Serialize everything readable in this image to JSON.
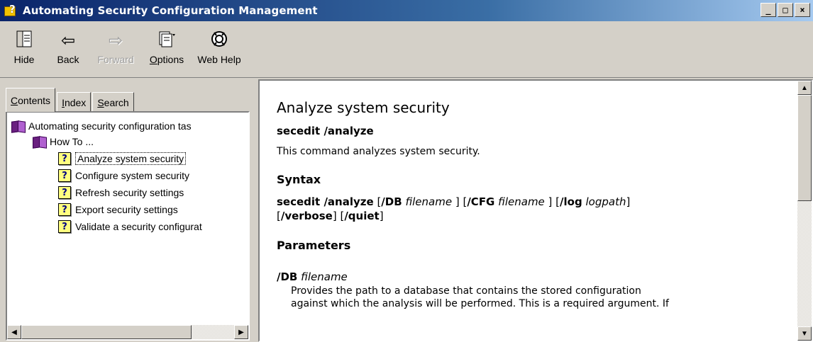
{
  "window": {
    "title": "Automating Security Configuration Management",
    "controls": [
      "_",
      "□",
      "×"
    ]
  },
  "toolbar": {
    "hide": {
      "icon": "hide-icon",
      "label": "Hide"
    },
    "back": {
      "icon": "back-arrow-icon",
      "label": "Back"
    },
    "forward": {
      "icon": "forward-arrow-icon",
      "label": "Forward",
      "disabled": true
    },
    "options": {
      "icon": "options-icon",
      "label_first": "O",
      "label_rest": "ptions"
    },
    "webhelp": {
      "icon": "web-help-icon",
      "label": "Web Help"
    }
  },
  "tabs": {
    "contents": {
      "u": "C",
      "rest": "ontents"
    },
    "index": {
      "u": "I",
      "rest": "ndex"
    },
    "search": {
      "u": "S",
      "rest": "earch"
    }
  },
  "tree": {
    "root": "Automating security configuration tas",
    "howto": "How To ...",
    "items": [
      "Analyze system security",
      "Configure system security",
      "Refresh security settings",
      "Export security settings",
      "Validate a security configurat"
    ],
    "selected_index": 0
  },
  "content": {
    "heading": "Analyze system security",
    "command": "secedit /analyze",
    "description": "This command analyzes system security.",
    "syntax_heading": "Syntax",
    "syntax": {
      "cmd": "secedit /analyze",
      "db_flag": "/DB",
      "db_arg": "filename",
      "cfg_flag": "/CFG",
      "cfg_arg": "filename",
      "log_flag": "/log",
      "log_arg": "logpath",
      "verbose_flag": "/verbose",
      "quiet_flag": "/quiet"
    },
    "parameters_heading": "Parameters",
    "param1": {
      "flag": "/DB",
      "arg": "filename",
      "line1": "Provides the path to a database that contains the stored configuration",
      "line2": "against which the analysis will be performed. This is a required argument. If"
    }
  }
}
